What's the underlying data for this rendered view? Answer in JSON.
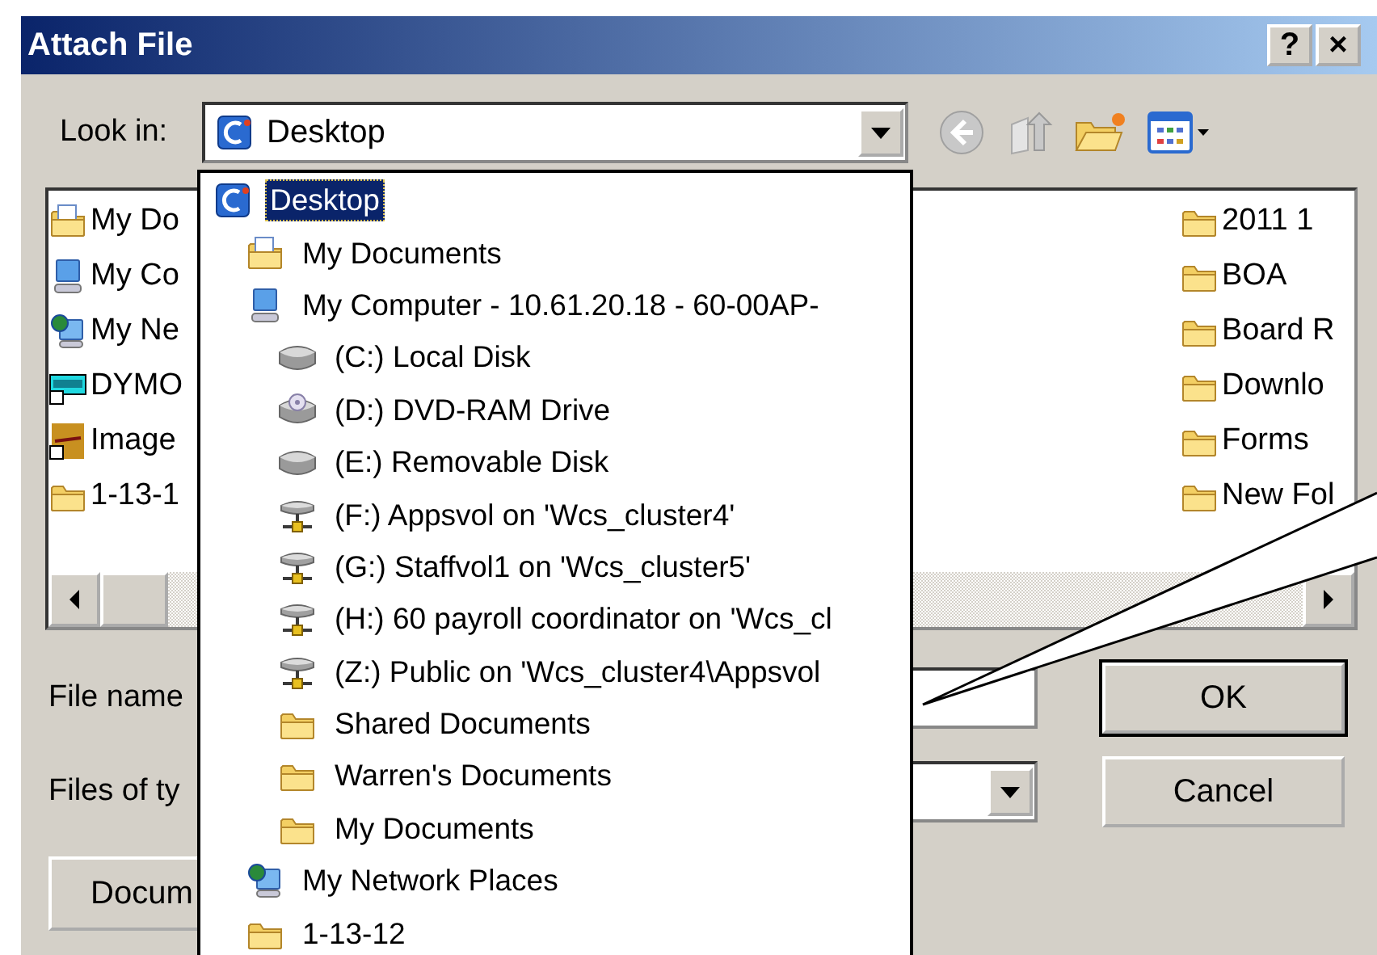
{
  "window": {
    "title": "Attach File",
    "help": "?",
    "close": "×"
  },
  "look_in": {
    "label": "Look in:",
    "value": "Desktop",
    "kind": "desktop"
  },
  "file_list": {
    "left_column": [
      {
        "name": "My Do",
        "kind": "documents"
      },
      {
        "name": "My Co",
        "kind": "computer"
      },
      {
        "name": "My Ne",
        "kind": "network"
      },
      {
        "name": "DYMO",
        "kind": "label-printer"
      },
      {
        "name": "Image",
        "kind": "image"
      },
      {
        "name": "1-13-1",
        "kind": "folder"
      }
    ],
    "right_column": [
      {
        "name": "2011 1",
        "kind": "folder"
      },
      {
        "name": "BOA",
        "kind": "folder"
      },
      {
        "name": "Board R",
        "kind": "folder"
      },
      {
        "name": "Downlo",
        "kind": "folder"
      },
      {
        "name": "Forms",
        "kind": "folder"
      },
      {
        "name": "New Fol",
        "kind": "folder"
      }
    ]
  },
  "file_name": {
    "label": "File name"
  },
  "files_of_type": {
    "label": "Files of ty"
  },
  "buttons": [
    {
      "label": "OK",
      "default": true
    },
    {
      "label": "Cancel",
      "default": false
    }
  ],
  "extra_button": {
    "label": "Docum"
  },
  "location_dropdown": {
    "items": [
      {
        "label": "Desktop",
        "kind": "desktop",
        "selected": true,
        "children": [
          {
            "label": "My Documents",
            "kind": "documents",
            "selected": false
          },
          {
            "label": "My Computer - 10.61.20.18 - 60-00AP-",
            "kind": "computer",
            "selected": false,
            "children": [
              {
                "label": "(C:) Local Disk",
                "kind": "disk",
                "selected": false
              },
              {
                "label": "(D:) DVD-RAM Drive",
                "kind": "cd-drive",
                "selected": false
              },
              {
                "label": "(E:) Removable Disk",
                "kind": "disk",
                "selected": false
              },
              {
                "label": "(F:) Appsvol on 'Wcs_cluster4'",
                "kind": "network-drive",
                "selected": false
              },
              {
                "label": "(G:) Staffvol1 on 'Wcs_cluster5'",
                "kind": "network-drive",
                "selected": false
              },
              {
                "label": "(H:) 60 payroll coordinator on 'Wcs_cl",
                "kind": "network-drive",
                "selected": false
              },
              {
                "label": "(Z:) Public on 'Wcs_cluster4\\Appsvol",
                "kind": "network-drive",
                "selected": false
              },
              {
                "label": "Shared Documents",
                "kind": "folder",
                "selected": false
              },
              {
                "label": "Warren's Documents",
                "kind": "folder",
                "selected": false
              },
              {
                "label": "My Documents",
                "kind": "folder",
                "selected": false
              }
            ]
          },
          {
            "label": "My Network Places",
            "kind": "network",
            "selected": false
          },
          {
            "label": "1-13-12",
            "kind": "folder",
            "selected": false
          }
        ]
      }
    ]
  }
}
